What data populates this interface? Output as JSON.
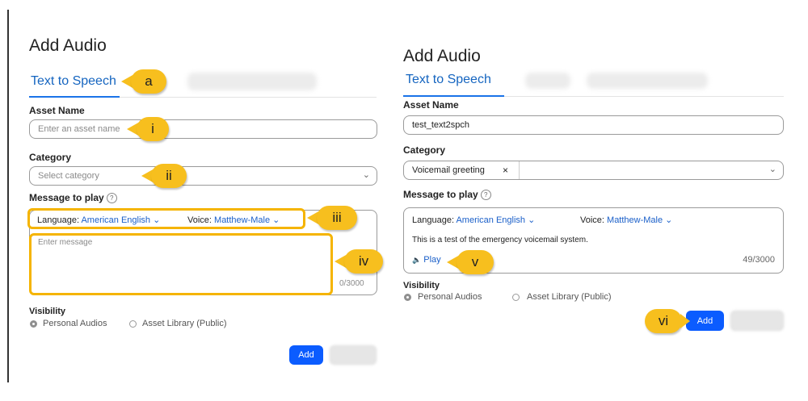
{
  "left": {
    "title": "Add Audio",
    "tab_active": "Text to Speech",
    "asset_name_label": "Asset Name",
    "asset_name_placeholder": "Enter an asset name",
    "category_label": "Category",
    "category_placeholder": "Select category",
    "message_label": "Message to play",
    "language_label": "Language:",
    "language_value": "American English",
    "voice_label": "Voice:",
    "voice_value": "Matthew-Male",
    "message_placeholder": "Enter message",
    "char_count": "0/3000",
    "visibility_label": "Visibility",
    "radio_personal": "Personal Audios",
    "radio_library": "Asset Library (Public)",
    "add_button": "Add"
  },
  "right": {
    "title": "Add Audio",
    "tab_active": "Text to Speech",
    "asset_name_label": "Asset Name",
    "asset_name_value": "test_text2spch",
    "category_label": "Category",
    "category_chip": "Voicemail greeting",
    "message_label": "Message to play",
    "language_label": "Language:",
    "language_value": "American English",
    "voice_label": "Voice:",
    "voice_value": "Matthew-Male",
    "message_value": "This is a test of the emergency voicemail system.",
    "play_label": "Play",
    "char_count": "49/3000",
    "visibility_label": "Visibility",
    "radio_personal": "Personal Audios",
    "radio_library": "Asset Library (Public)",
    "add_button": "Add"
  },
  "callouts": {
    "a": "a",
    "i": "i",
    "ii": "ii",
    "iii": "iii",
    "iv": "iv",
    "v": "v",
    "vi": "vi"
  },
  "glyphs": {
    "chevron": "⌄",
    "chip_close": "×",
    "help": "?",
    "speaker": "🔈"
  },
  "colors": {
    "accent": "#1a73e8",
    "link": "#1a5fc9",
    "callout": "#f7bf1e",
    "highlight": "#f5b400",
    "add_button": "#0b5cff"
  }
}
